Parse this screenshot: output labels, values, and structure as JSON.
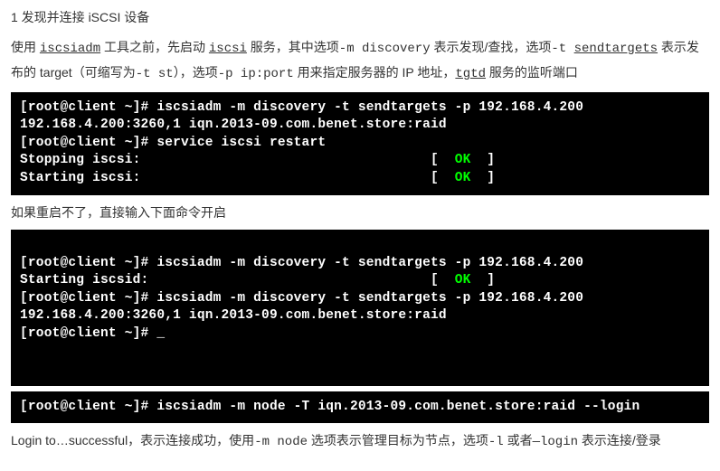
{
  "section": {
    "heading": "1 发现并连接 iSCSI 设备",
    "intro_p1": "使用 ",
    "intro_cmd1": "iscsiadm",
    "intro_p2": " 工具之前，先启动 ",
    "intro_cmd2": "iscsi",
    "intro_p3": " 服务，其中选项",
    "intro_opt_m": "-m discovery",
    "intro_p4": " 表示发现/查找，选项",
    "intro_opt_t": "-t ",
    "intro_sendtargets": "sendtargets",
    "intro_line2a": " 表示发布的 target（可缩写为",
    "intro_tst": "-t st",
    "intro_line2b": "），选项",
    "intro_pp": "-p ip:port",
    "intro_line2c": " 用来指定服务器的 IP 地址，",
    "intro_tgtd": "tgtd",
    "intro_line2d": " 服务的监听端口"
  },
  "term1": {
    "l1": "[root@client ~]# iscsiadm -m discovery -t sendtargets -p 192.168.4.200",
    "l2": "192.168.4.200:3260,1 iqn.2013-09.com.benet.store:raid",
    "l3": "[root@client ~]# service iscsi restart",
    "l4a": "Stopping iscsi:                                    [  ",
    "l4ok": "OK",
    "l4b": "  ]",
    "l5a": "Starting iscsi:                                    [  ",
    "l5ok": "OK",
    "l5b": "  ]"
  },
  "mid_text": "如果重启不了，直接输入下面命令开启",
  "term2": {
    "blank_top": " ",
    "l1": "[root@client ~]# iscsiadm -m discovery -t sendtargets -p 192.168.4.200",
    "l2a": "Starting iscsid:                                   [  ",
    "l2ok": "OK",
    "l2b": "  ]",
    "l3": "[root@client ~]# iscsiadm -m discovery -t sendtargets -p 192.168.4.200",
    "l4": "192.168.4.200:3260,1 iqn.2013-09.com.benet.store:raid",
    "l5": "[root@client ~]# _",
    "blank_bot1": " ",
    "blank_bot2": " "
  },
  "term3": {
    "l1": "[root@client ~]# iscsiadm -m node -T iqn.2013-09.com.benet.store:raid --login"
  },
  "footer": {
    "t1": "Login to…successful，表示连接成功，使用",
    "opt_m": "-m node",
    "t2": " 选项表示管理目标为节点，选项",
    "opt_l": "-l",
    "t3": " 或者",
    "opt_login": "—login",
    "t4": " 表示连接/登录"
  }
}
